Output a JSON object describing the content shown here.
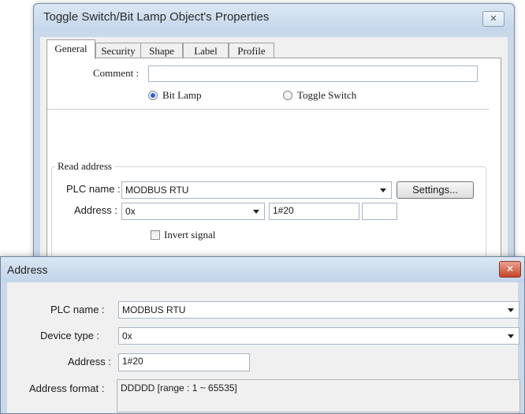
{
  "props_dialog": {
    "title": "Toggle Switch/Bit Lamp Object's Properties",
    "close_glyph": "✕",
    "tabs": [
      {
        "label": "General"
      },
      {
        "label": "Security"
      },
      {
        "label": "Shape"
      },
      {
        "label": "Label"
      },
      {
        "label": "Profile"
      }
    ],
    "active_tab": "General",
    "comment_label": "Comment :",
    "comment_value": "",
    "radio_bit_lamp": "Bit Lamp",
    "radio_toggle_switch": "Toggle Switch",
    "selected_radio": "Bit Lamp",
    "read_address": {
      "group_title": "Read address",
      "plc_name_label": "PLC name :",
      "plc_name_value": "MODBUS RTU",
      "settings_button": "Settings...",
      "address_label": "Address :",
      "device_type_value": "0x",
      "address_value": "1#20",
      "extra_value": "",
      "invert_signal_label": "Invert signal",
      "invert_signal_checked": false
    }
  },
  "address_dialog": {
    "title": "Address",
    "close_glyph": "✕",
    "plc_name_label": "PLC name :",
    "plc_name_value": "MODBUS RTU",
    "device_type_label": "Device type :",
    "device_type_value": "0x",
    "address_label": "Address :",
    "address_value": "1#20",
    "address_format_label": "Address format :",
    "address_format_value": "DDDDD [range : 1 ~ 65535]"
  },
  "colors": {
    "title_bar": "#c9d9ea",
    "close_red": "#c7452a",
    "radio_selected": "#2a64c8"
  }
}
